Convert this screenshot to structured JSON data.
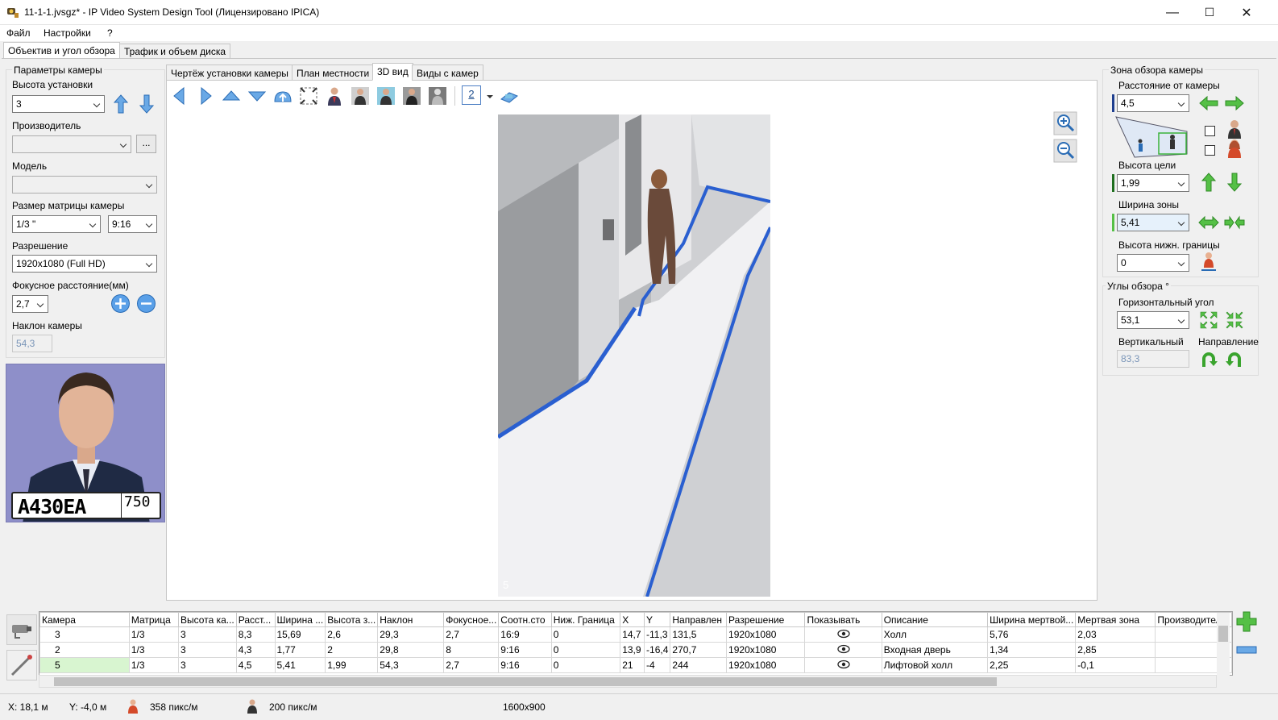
{
  "window": {
    "title": "11-1-1.jvsgz* - IP Video System Design Tool (Лицензировано  IPICA)",
    "minimize": "—",
    "maximize": "☐",
    "close": "✕"
  },
  "menu": [
    "Файл",
    "Настройки",
    "?"
  ],
  "main_tabs": [
    "Объектив и угол обзора",
    "Трафик и объем диска"
  ],
  "left": {
    "group_title": "Параметры камеры",
    "height_label": "Высота установки",
    "height_value": "3",
    "manufacturer_label": "Производитель",
    "manufacturer_value": "",
    "browse_label": "...",
    "model_label": "Модель",
    "model_value": "",
    "sensor_label": "Размер матрицы камеры",
    "sensor_value": "1/3 \"",
    "aspect_value": "9:16",
    "resolution_label": "Разрешение",
    "resolution_value": "1920x1080 (Full HD)",
    "focal_label": "Фокусное расстояние(мм)",
    "focal_value": "2,7",
    "tilt_label": "Наклон камеры",
    "tilt_value": "54,3",
    "plate_text": "А430ЕА",
    "plate_region": "750"
  },
  "view_tabs": [
    "Чертёж установки камеры",
    "План местности",
    "3D вид",
    "Виды с камер"
  ],
  "toolbar": {
    "camera_count": "2"
  },
  "viewport": {
    "camera_number": "5"
  },
  "right": {
    "zone_title": "Зона обзора камеры",
    "distance_label": "Расстояние от камеры",
    "distance_value": "4,5",
    "target_height_label": "Высота цели",
    "target_height_value": "1,99",
    "zone_width_label": "Ширина зоны",
    "zone_width_value": "5,41",
    "lower_bound_label": "Высота нижн. границы",
    "lower_bound_value": "0",
    "angles_title": "Углы обзора °",
    "horizontal_label": "Горизонтальный угол",
    "horizontal_value": "53,1",
    "vertical_label": "Вертикальный",
    "vertical_value": "83,3",
    "direction_label": "Направление"
  },
  "grid": {
    "columns": [
      "Камера",
      "Матрица",
      "Высота ка...",
      "Расст...",
      "Ширина ...",
      "Высота з...",
      "Наклон",
      "Фокусное...",
      "Соотн.сто",
      "Ниж. Граница",
      "X",
      "Y",
      "Направлен",
      "Разрешение",
      "Показывать",
      "Описание",
      "Ширина мертвой...",
      "Мертвая зона",
      "Производитель"
    ],
    "rows": [
      [
        "3",
        "1/3",
        "3",
        "8,3",
        "15,69",
        "2,6",
        "29,3",
        "2,7",
        "16:9",
        "0",
        "14,7",
        "-11,3",
        "131,5",
        "1920x1080",
        "",
        "Холл",
        "5,76",
        "2,03",
        ""
      ],
      [
        "2",
        "1/3",
        "3",
        "4,3",
        "1,77",
        "2",
        "29,8",
        "8",
        "9:16",
        "0",
        "13,9",
        "-16,4",
        "270,7",
        "1920x1080",
        "",
        "Входная дверь",
        "1,34",
        "2,85",
        ""
      ],
      [
        "5",
        "1/3",
        "3",
        "4,5",
        "5,41",
        "1,99",
        "54,3",
        "2,7",
        "9:16",
        "0",
        "21",
        "-4",
        "244",
        "1920x1080",
        "",
        "Лифтовой холл",
        "2,25",
        "-0,1",
        ""
      ]
    ]
  },
  "status": {
    "x": "X: 18,1 м",
    "y": "Y: -4,0 м",
    "density1": "358 пикс/м",
    "density2": "200 пикс/м",
    "resolution": "1600x900"
  }
}
